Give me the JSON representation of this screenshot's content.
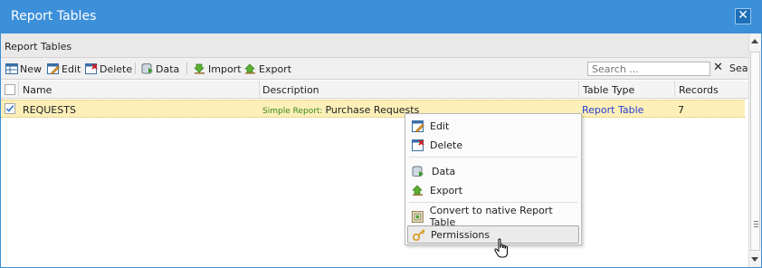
{
  "window": {
    "title": "Report Tables"
  },
  "panel": {
    "title": "Report Tables"
  },
  "toolbar": {
    "new_label": "New",
    "edit_label": "Edit",
    "delete_label": "Delete",
    "data_label": "Data",
    "import_label": "Import",
    "export_label": "Export",
    "search_placeholder": "Search ...",
    "search_label": "Sear"
  },
  "grid": {
    "columns": [
      "Name",
      "Description",
      "Table Type",
      "Records"
    ],
    "rows": [
      {
        "name": "REQUESTS",
        "description_prefix": "Simple Report:",
        "description": "Purchase Requests",
        "table_type": "Report Table",
        "records": "7",
        "checked": true
      }
    ]
  },
  "context_menu": {
    "items": [
      {
        "label": "Edit",
        "icon": "edit-icon"
      },
      {
        "label": "Delete",
        "icon": "delete-icon"
      },
      {
        "label": "Data",
        "icon": "data-icon"
      },
      {
        "label": "Export",
        "icon": "export-icon"
      },
      {
        "label": "Convert to native Report Table",
        "icon": "convert-icon"
      },
      {
        "label": "Permissions",
        "icon": "permissions-icon"
      }
    ]
  },
  "colors": {
    "titlebar": "#3c8fd9",
    "row_highlight": "#fcefb8",
    "link": "#2a3ed6",
    "prefix": "#3b8a1c"
  }
}
